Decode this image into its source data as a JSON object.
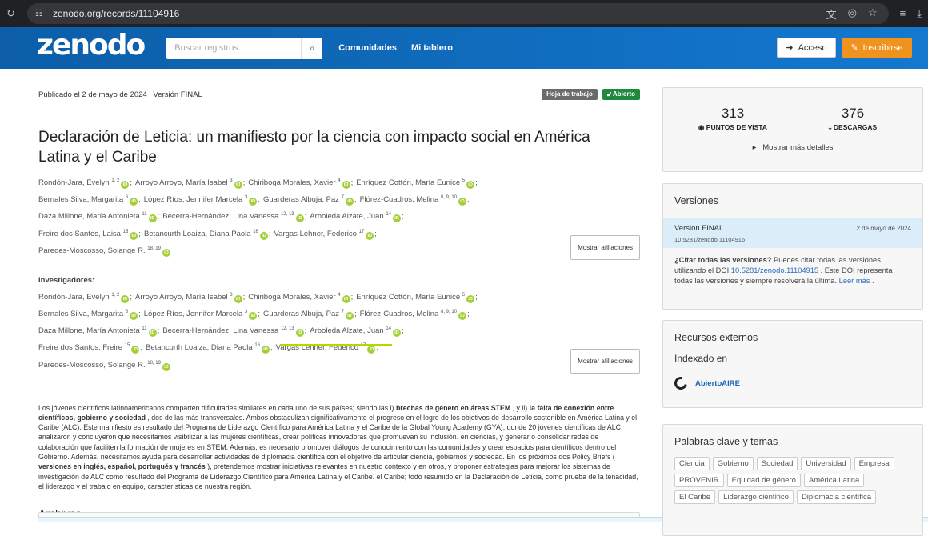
{
  "browser": {
    "url": "zenodo.org/records/11104916"
  },
  "header": {
    "logo": "zenodo",
    "search_placeholder": "Buscar registros...",
    "nav": [
      "Comunidades",
      "Mi tablero"
    ],
    "login": "Acceso",
    "signup": "Inscribirse"
  },
  "record": {
    "published": "Publicado el 2 de mayo de 2024 | Versión FINAL",
    "badge_type": "Hoja de trabajo",
    "badge_access": "Abierto",
    "title": "Declaración de Leticia: un manifiesto por la ciencia con impacto social en América Latina y el Caribe",
    "creators": [
      {
        "name": "Rondón-Jara, Evelyn",
        "sup": "1, 2"
      },
      {
        "name": "Arroyo Arroyo, María Isabel",
        "sup": "3"
      },
      {
        "name": "Chiriboga Morales, Xavier",
        "sup": "4"
      },
      {
        "name": "Enríquez Cottón, María Eunice",
        "sup": "5"
      },
      {
        "name": "Bernales Silva, Margarita",
        "sup": "6"
      },
      {
        "name": "López Ríos, Jennifer Marcela",
        "sup": "3"
      },
      {
        "name": "Guarderas Albuja, Paz",
        "sup": "7"
      },
      {
        "name": "Flórez-Cuadros, Melina",
        "sup": "8, 9, 10"
      },
      {
        "name": "Daza Millone, María Antonieta",
        "sup": "11"
      },
      {
        "name": "Becerra-Hernández, Lina Vanessa",
        "sup": "12, 13"
      },
      {
        "name": "Arboleda Alzate, Juan",
        "sup": "14"
      },
      {
        "name": "Freire dos Santos, Laisa",
        "sup": "15"
      },
      {
        "name": "Betancurth Loaiza, Diana Paola",
        "sup": "16"
      },
      {
        "name": "Vargas Lehner, Federico",
        "sup": "17"
      },
      {
        "name": "Paredes-Moscosso, Solange R.",
        "sup": "18, 19"
      }
    ],
    "creator_lines": [
      4,
      4,
      3,
      3,
      1
    ],
    "show_affiliations": "Mostrar afiliaciones",
    "contributors_label": "Investigadores:",
    "contributors": [
      {
        "name": "Rondón-Jara, Evelyn",
        "sup": "1, 2"
      },
      {
        "name": "Arroyo Arroyo, María Isabel",
        "sup": "3"
      },
      {
        "name": "Chiriboga Morales, Xavier",
        "sup": "4"
      },
      {
        "name": "Enríquez Cottón, María Eunice",
        "sup": "5"
      },
      {
        "name": "Bernales Silva, Margarita",
        "sup": "6"
      },
      {
        "name": "López Ríos, Jennifer Marcela",
        "sup": "3"
      },
      {
        "name": "Guarderas Albuja, Paz",
        "sup": "7"
      },
      {
        "name": "Flórez-Cuadros, Melina",
        "sup": "8, 9, 10"
      },
      {
        "name": "Daza Millone, María Antonieta",
        "sup": "11"
      },
      {
        "name": "Becerra-Hernández, Lina Vanessa",
        "sup": "12, 13"
      },
      {
        "name": "Arboleda Alzate, Juan",
        "sup": "14"
      },
      {
        "name": "Freire dos Santos, Freire",
        "sup": "15"
      },
      {
        "name": "Betancurth Loaiza, Diana Paola",
        "sup": "16"
      },
      {
        "name": "Vargas Lehner, Federico",
        "sup": "17"
      },
      {
        "name": "Paredes-Moscosso, Solange R.",
        "sup": "18, 19"
      }
    ],
    "contributor_lines": [
      4,
      4,
      3,
      3,
      1
    ],
    "abstract": [
      {
        "t": "Los jóvenes científicos latinoamericanos comparten dificultades similares en cada uno de sus países; siendo las i) "
      },
      {
        "t": "brechas de género en áreas STEM",
        "b": true
      },
      {
        "t": " , y ii) "
      },
      {
        "t": "la falta de conexión entre científicos, gobierno y sociedad",
        "b": true
      },
      {
        "t": " , dos de las más transversales. Ambos obstaculizan significativamente el progreso en el logro de los objetivos de desarrollo sostenible en América Latina y el Caribe (ALC). Este manifiesto es resultado del Programa de Liderazgo Científico para América Latina y el Caribe de la Global Young Academy (GYA), donde 20 jóvenes científicas de ALC analizaron y concluyeron que necesitamos visibilizar a las mujeres científicas, crear políticas innovadoras que promuevan su inclusión. en ciencias, y generar o consolidar redes de colaboración que faciliten la formación de mujeres en STEM. Además, es necesario promover diálogos de conocimiento con las comunidades y crear espacios para científicos dentro del Gobierno. Además, necesitamos ayuda para desarrollar actividades de diplomacia científica con el objetivo de articular ciencia, gobiernos y sociedad. En los próximos dos Policy Briefs ( "
      },
      {
        "t": "versiones en inglés, español, portugués y francés",
        "b": true
      },
      {
        "t": " ), pretendemos mostrar iniciativas relevantes en nuestro contexto y en otros, y proponer estrategias para mejorar los sistemas de investigación de ALC como resultado del Programa de Liderazgo Científico para América Latina y el Caribe. el Caribe; todo resumido en la Declaración de Leticia, como prueba de la tenacidad, el liderazgo y el trabajo en equipo, características de nuestra región."
      }
    ],
    "files_heading": "Archivos"
  },
  "sidebar": {
    "views_count": "313",
    "views_label": "PUNTOS DE VISTA",
    "downloads_count": "376",
    "downloads_label": "DESCARGAS",
    "more_details": "Mostrar más detalles",
    "versions_heading": "Versiones",
    "version_name": "Versión FINAL",
    "version_date": "2 de mayo de 2024",
    "version_doi": "10.5281/zenodo.11104916",
    "cite_bold": "¿Citar todas las versiones?",
    "cite_text1": " Puedes citar todas las versiones utilizando el DOI ",
    "cite_doi": "10.5281/zenodo.11104915",
    "cite_text2": " . Este DOI representa todas las versiones y siempre resolverá la última. ",
    "cite_more": "Leer más",
    "cite_end": " .",
    "resources_heading": "Recursos externos",
    "indexed_in": "Indexado en",
    "resource_name": "AbiertoAIRE",
    "keywords_heading": "Palabras clave y temas",
    "keywords": [
      "Ciencia",
      "Gobierno",
      "Sociedad",
      "Universidad",
      "Empresa",
      "PROVENIR",
      "Equidad de género",
      "América Latina",
      "El Caribe",
      "Liderazgo científico",
      "Diplomacia científica"
    ]
  }
}
